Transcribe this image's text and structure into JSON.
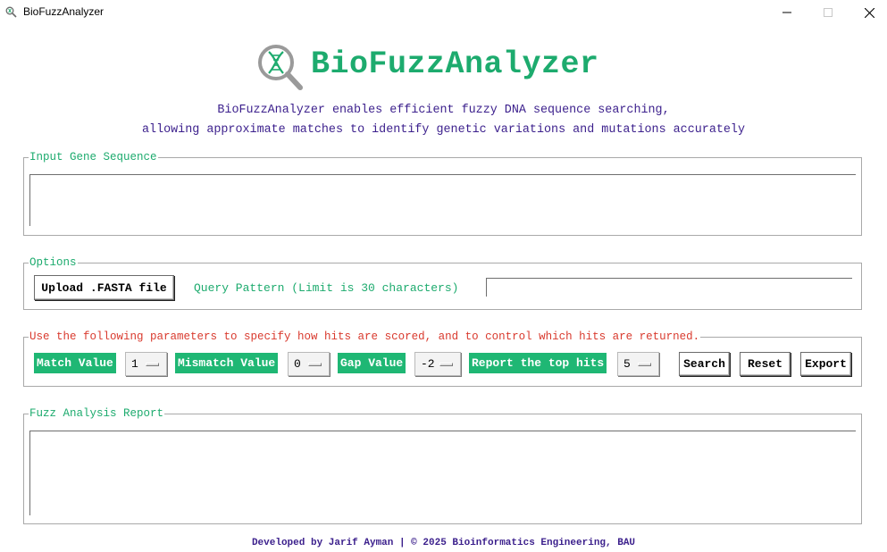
{
  "window": {
    "title": "BioFuzzAnalyzer",
    "minimize_icon": "minimize-icon",
    "maximize_icon": "maximize-icon",
    "close_icon": "close-icon"
  },
  "header": {
    "logo_icon": "dna-magnifier-icon",
    "app_name": "BioFuzzAnalyzer",
    "description_line1": "BioFuzzAnalyzer enables efficient fuzzy DNA sequence searching,",
    "description_line2": "allowing approximate matches to identify genetic variations and mutations accurately"
  },
  "input_section": {
    "legend": "Input Gene Sequence",
    "value": ""
  },
  "options": {
    "legend": "Options",
    "upload_label": "Upload .FASTA file",
    "query_label": "Query Pattern (Limit is 30 characters)",
    "query_value": ""
  },
  "params": {
    "legend": "Use the following parameters to specify how hits are scored, and to control which hits are returned.",
    "match_label": "Match Value",
    "match_value": "1",
    "mismatch_label": "Mismatch Value",
    "mismatch_value": "0",
    "gap_label": "Gap Value",
    "gap_value": "-2",
    "top_hits_label": "Report the top hits",
    "top_hits_value": "5",
    "search_label": "Search",
    "reset_label": "Reset",
    "export_label": "Export"
  },
  "report": {
    "legend": "Fuzz Analysis Report",
    "value": ""
  },
  "footer": {
    "text": "Developed by Jarif Ayman | © 2025 Bioinformatics Engineering, BAU"
  },
  "colors": {
    "accent_green": "#1dab6e",
    "label_green_bg": "#1fb774",
    "description_purple": "#3b1f8c",
    "legend_red": "#d93a2e"
  }
}
